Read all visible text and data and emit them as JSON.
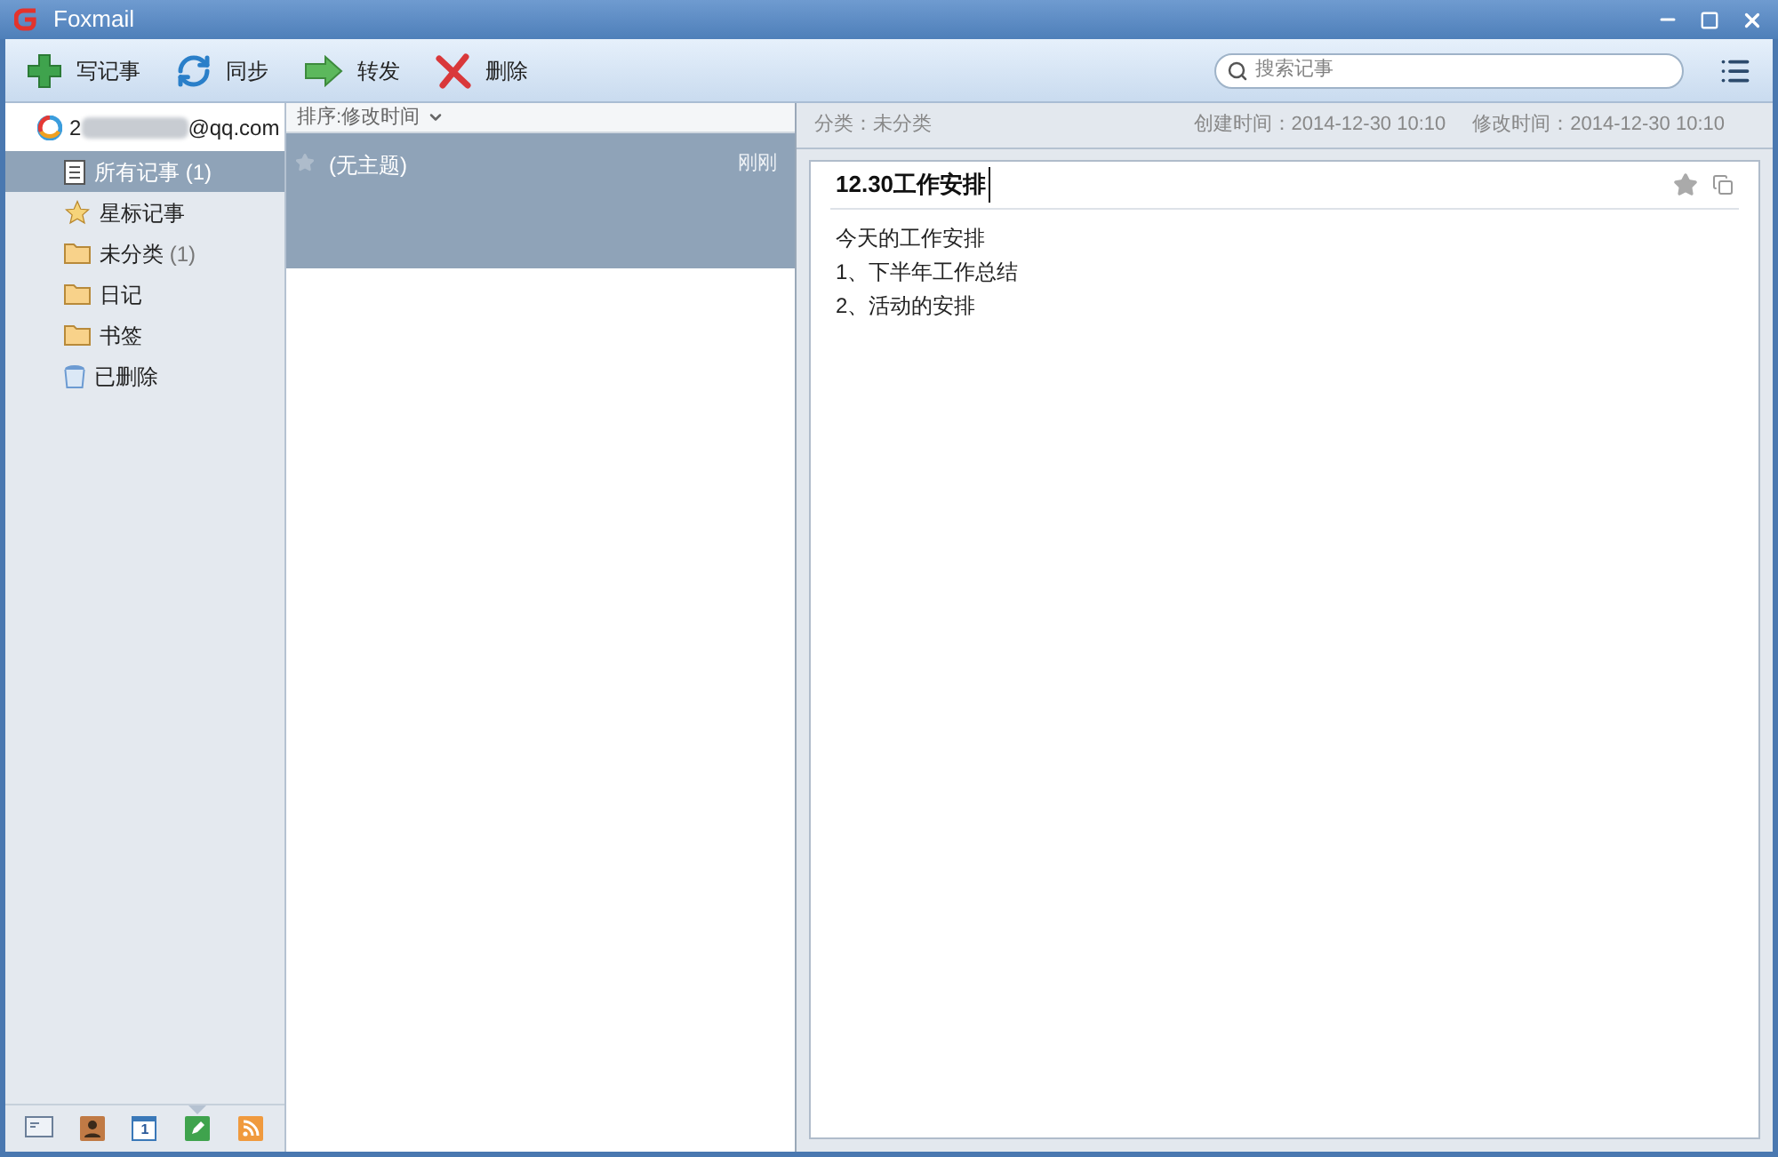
{
  "window": {
    "title": "Foxmail"
  },
  "toolbar": {
    "buttons": [
      {
        "kind": "new",
        "label": "写记事"
      },
      {
        "kind": "sync",
        "label": "同步"
      },
      {
        "kind": "forward",
        "label": "转发"
      },
      {
        "kind": "delete",
        "label": "删除"
      }
    ],
    "search": {
      "placeholder": "搜索记事"
    }
  },
  "sidebar": {
    "account_start": "2",
    "account_end": "@qq.com",
    "items": [
      {
        "kind": "all",
        "label": "所有记事",
        "count": "(1)",
        "selected": true
      },
      {
        "kind": "star",
        "label": "星标记事",
        "selected": false
      },
      {
        "kind": "folder",
        "label": "未分类",
        "count": "(1)",
        "selected": false
      },
      {
        "kind": "folder",
        "label": "日记",
        "selected": false
      },
      {
        "kind": "folder",
        "label": "书签",
        "selected": false
      },
      {
        "kind": "trash",
        "label": "已删除",
        "selected": false
      }
    ],
    "nav": [
      {
        "kind": "mail",
        "selected": false
      },
      {
        "kind": "contacts",
        "selected": false
      },
      {
        "kind": "calendar",
        "text": "1",
        "selected": false
      },
      {
        "kind": "notes",
        "selected": true
      },
      {
        "kind": "rss",
        "selected": false
      }
    ]
  },
  "list": {
    "sort": "排序:修改时间",
    "notes": [
      {
        "title": "(无主题)",
        "time": "刚刚",
        "selected": true,
        "starred": false
      }
    ]
  },
  "note": {
    "category": "分类：未分类",
    "created": "创建时间：2014-12-30 10:10",
    "modified": "修改时间：2014-12-30 10:10",
    "title": "12.30工作安排",
    "lines": [
      "今天的工作安排",
      "1、下半年工作总结",
      "2、活动的安排"
    ]
  }
}
